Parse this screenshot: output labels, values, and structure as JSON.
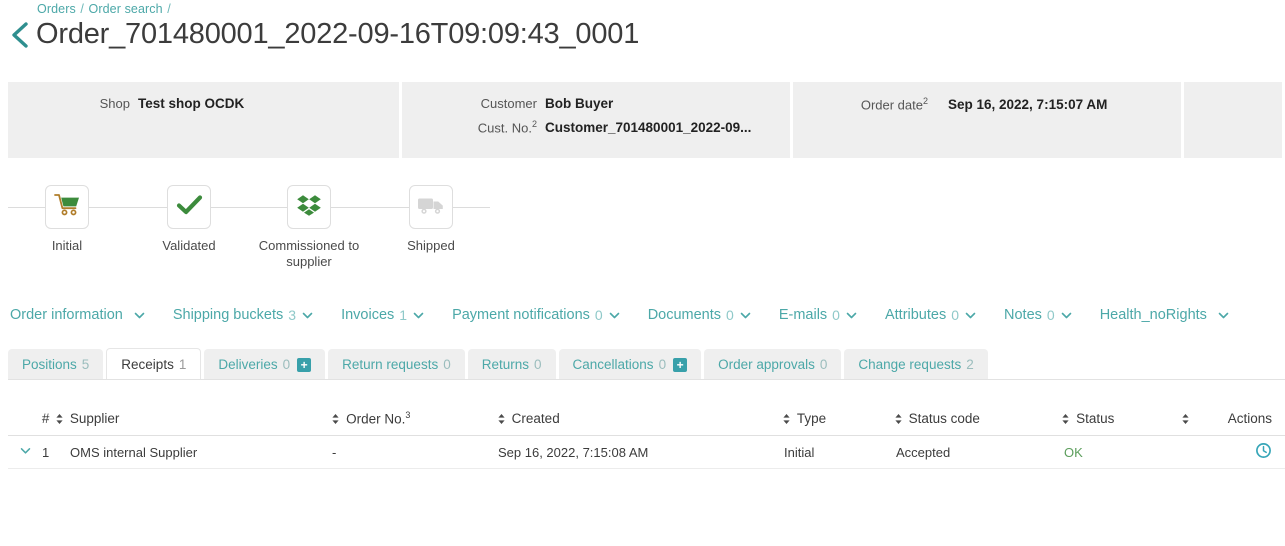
{
  "breadcrumb": {
    "items": [
      "Orders",
      "Order search"
    ],
    "separator": "/"
  },
  "header": {
    "title": "Order_701480001_2022-09-16T09:09:43_0001",
    "back_icon": "chevron-left-icon"
  },
  "info": {
    "shop": {
      "label": "Shop",
      "value": "Test shop OCDK"
    },
    "customer": {
      "label": "Customer",
      "value": "Bob Buyer"
    },
    "customer_no": {
      "label": "Cust. No.",
      "sup": "2",
      "value": "Customer_701480001_2022-09..."
    },
    "order_date": {
      "label": "Order date",
      "sup": "2",
      "value": "Sep 16, 2022, 7:15:07 AM"
    }
  },
  "stepper": {
    "steps": [
      {
        "label": "Initial",
        "icon": "shopping-cart-icon",
        "state": "done"
      },
      {
        "label": "Validated",
        "icon": "check-icon",
        "state": "done"
      },
      {
        "label": "Commissioned to supplier",
        "icon": "boxes-icon",
        "state": "done"
      },
      {
        "label": "Shipped",
        "icon": "truck-icon",
        "state": "inactive"
      }
    ]
  },
  "nav": {
    "items": [
      {
        "label": "Order information",
        "count": ""
      },
      {
        "label": "Shipping buckets",
        "count": "3"
      },
      {
        "label": "Invoices",
        "count": "1"
      },
      {
        "label": "Payment notifications",
        "count": "0"
      },
      {
        "label": "Documents",
        "count": "0"
      },
      {
        "label": "E-mails",
        "count": "0"
      },
      {
        "label": "Attributes",
        "count": "0"
      },
      {
        "label": "Notes",
        "count": "0"
      },
      {
        "label": "Health_noRights",
        "count": ""
      }
    ]
  },
  "tabs": [
    {
      "label": "Positions",
      "count": "5",
      "active": false,
      "plus": false
    },
    {
      "label": "Receipts",
      "count": "1",
      "active": true,
      "plus": false
    },
    {
      "label": "Deliveries",
      "count": "0",
      "active": false,
      "plus": true
    },
    {
      "label": "Return requests",
      "count": "0",
      "active": false,
      "plus": false
    },
    {
      "label": "Returns",
      "count": "0",
      "active": false,
      "plus": false
    },
    {
      "label": "Cancellations",
      "count": "0",
      "active": false,
      "plus": true
    },
    {
      "label": "Order approvals",
      "count": "0",
      "active": false,
      "plus": false
    },
    {
      "label": "Change requests",
      "count": "2",
      "active": false,
      "plus": false
    }
  ],
  "table": {
    "columns": {
      "num": "#",
      "supplier": "Supplier",
      "order_no": "Order No.",
      "order_no_sup": "3",
      "created": "Created",
      "type": "Type",
      "status_code": "Status code",
      "status": "Status",
      "actions": "Actions"
    },
    "rows": [
      {
        "num": "1",
        "supplier": "OMS internal Supplier",
        "order_no": "-",
        "created": "Sep 16, 2022, 7:15:08 AM",
        "type": "Initial",
        "status_code": "Accepted",
        "status": "OK",
        "action_icon": "history-clock-icon"
      }
    ]
  },
  "colors": {
    "teal": "#4ca8a8",
    "teal_badge": "#38a0aa",
    "green": "#3c8b3c",
    "status_ok": "#5c9e5c",
    "panel_gray": "#efefef"
  }
}
